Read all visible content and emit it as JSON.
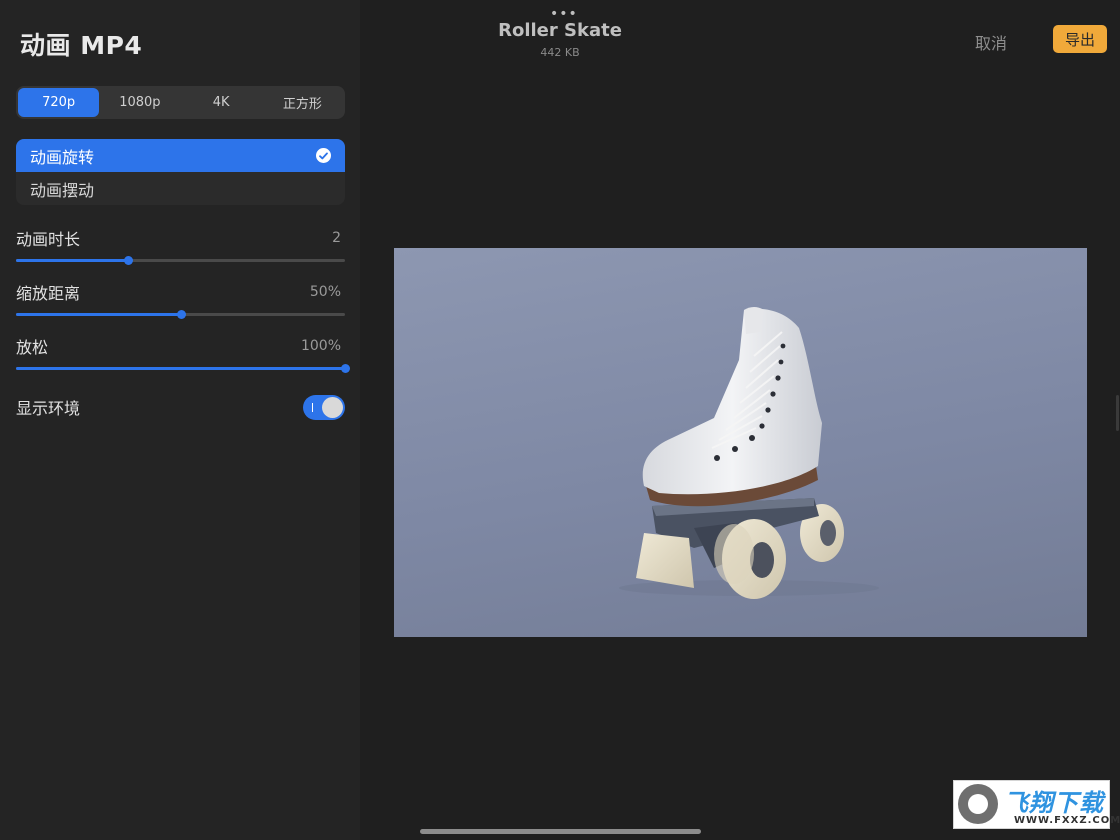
{
  "panel": {
    "title": "动画 MP4",
    "resolution_options": [
      "720p",
      "1080p",
      "4K",
      "正方形"
    ],
    "resolution_selected": "720p",
    "animation_options": [
      "动画旋转",
      "动画摆动"
    ],
    "animation_selected": "动画旋转",
    "sliders": [
      {
        "label": "动画时长",
        "value": "2",
        "fraction": 0.34
      },
      {
        "label": "缩放距离",
        "value": "50%",
        "fraction": 0.5
      },
      {
        "label": "放松",
        "value": "100%",
        "fraction": 1.0
      }
    ],
    "toggle": {
      "label": "显示环境",
      "on": true
    }
  },
  "header": {
    "more_glyph": "•••",
    "title": "Roller Skate",
    "file_size": "442 KB",
    "cancel_label": "取消",
    "export_label": "导出"
  },
  "watermark": {
    "text": "飞翔下载",
    "url": "WWW.FXXZ.COM"
  },
  "colors": {
    "accent": "#2d74ea",
    "export": "#f0a93a",
    "background": "#1f1f1f",
    "panel": "#242424"
  },
  "icons": {
    "check": "check-circle-icon",
    "more": "more-dots-icon"
  }
}
